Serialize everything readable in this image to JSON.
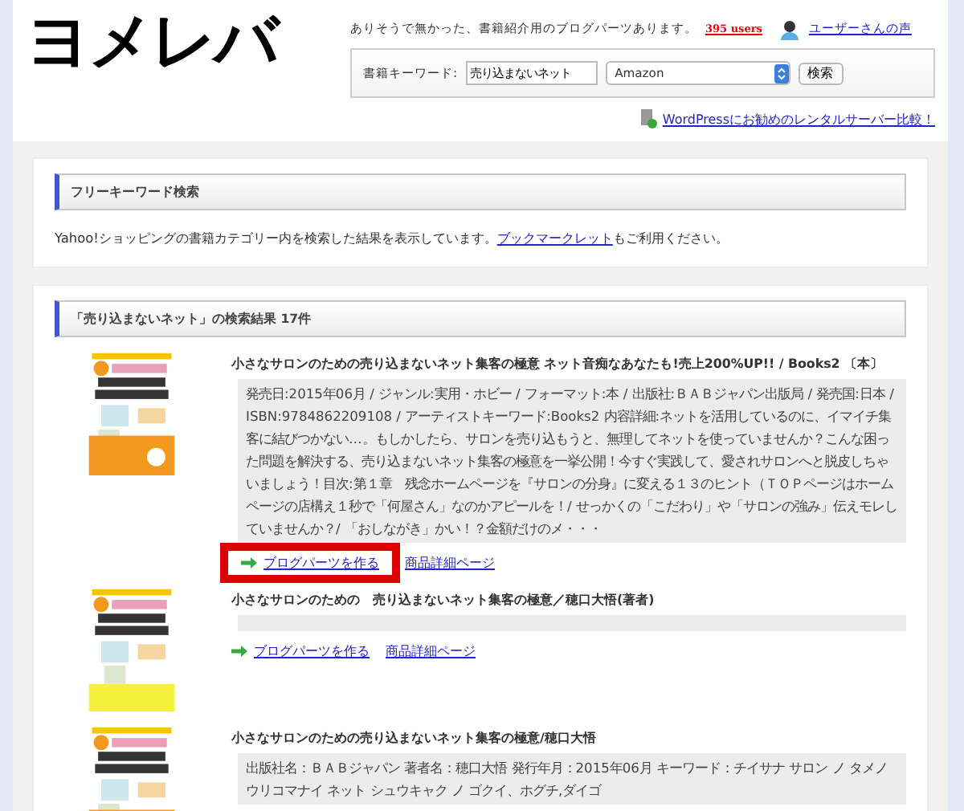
{
  "header": {
    "logo": "ヨメレバ",
    "tagline": "ありそうで無かった、書籍紹介用のブログパーツあります。",
    "users_badge": "395 users",
    "voices_link": "ユーザーさんの声",
    "search": {
      "label": "書籍キーワード:",
      "value": "売り込まないネット",
      "store": "Amazon",
      "button": "検索"
    },
    "wordpress_link": "WordPressにお勧めのレンタルサーバー比較！"
  },
  "free_search": {
    "title": "フリーキーワード検索",
    "text_before": "Yahoo!ショッピングの書籍カテゴリー内を検索した結果を表示しています。",
    "link": "ブックマークレット",
    "text_after": "もご利用ください。"
  },
  "results": {
    "title": "「売り込まないネット」の検索結果 17件",
    "items": [
      {
        "title": "小さなサロンのための売り込まないネット集客の極意 ネット音痴なあなたも!売上200%UP!! / Books2 〔本〕",
        "description": "発売日:2015年06月 / ジャンル:実用・ホビー / フォーマット:本 / 出版社:ＢＡＢジャパン出版局 / 発売国:日本 / ISBN:9784862209108 / アーティストキーワード:Books2 内容詳細:ネットを活用しているのに、イマイチ集客に結びつかない…。もしかしたら、サロンを売り込もうと、無理してネットを使っていませんか？こんな困った問題を解決する、売り込まないネット集客の極意を一挙公開！今すぐ実践して、愛されサロンへと脱皮しちゃいましょう！目次:第１章　残念ホームページを『サロンの分身』に変える１３のヒント（ＴＯＰページはホームページの店構え１秒で「何屋さん」なのかアピールを！/ せっかくの「こだわり」や「サロンの強み」伝えモレしていませんか？/ 「おしながき」かい！？金額だけのメ・・・",
        "actions": [
          {
            "label": "ブログパーツを作る",
            "kind": "blog-parts",
            "highlighted": true
          },
          {
            "label": "商品詳細ページ",
            "kind": "detail",
            "highlighted": false
          }
        ]
      },
      {
        "title": "小さなサロンのための　売り込まないネット集客の極意／穂口大悟(著者)",
        "actions": [
          {
            "label": "ブログパーツを作る",
            "kind": "blog-parts",
            "highlighted": false
          },
          {
            "label": "商品詳細ページ",
            "kind": "detail",
            "highlighted": false
          }
        ]
      },
      {
        "title": "小さなサロンのための売り込まないネット集客の極意/穂口大悟",
        "description": "出版社名：ＢＡＢジャパン 著者名：穂口大悟 発行年月：2015年06月 キーワード：チイサナ サロン ノ タメノウリコマナイ ネット シュウキャク ノ ゴクイ、ホグチ,ダイゴ"
      }
    ]
  }
}
